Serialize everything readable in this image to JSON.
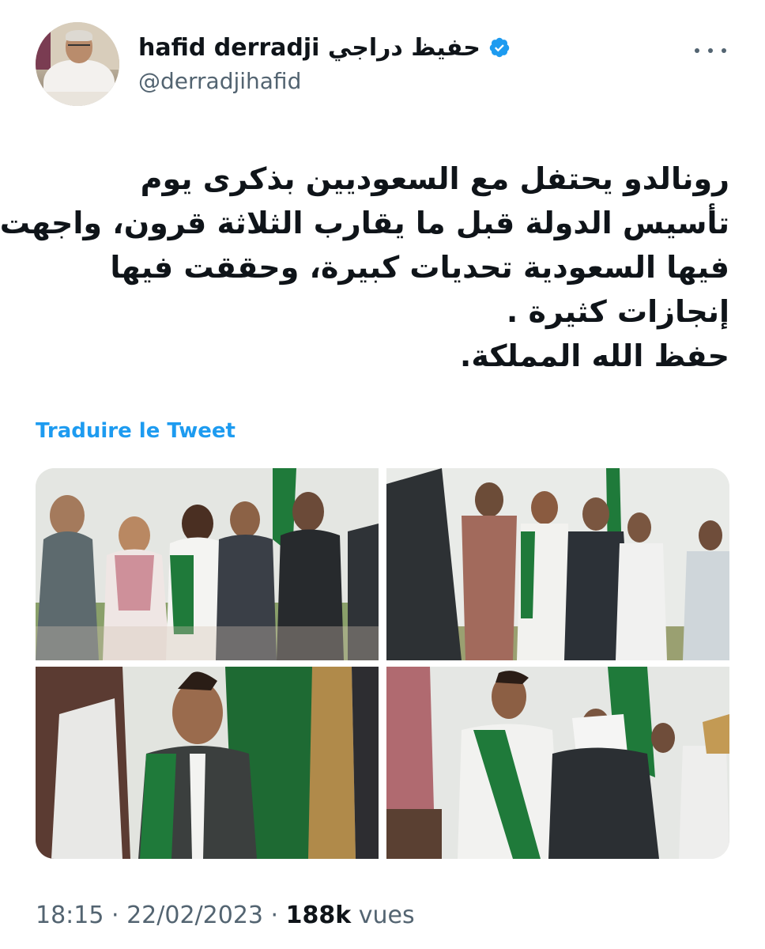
{
  "user": {
    "display_name": "hafid derradji حفيظ دراجي",
    "handle": "@derradjihafid",
    "verified_icon": "verified-badge-icon",
    "verified_color": "#1d9bf0"
  },
  "tweet": {
    "lines": [
      "رونالدو يحتفل مع السعوديين بذكرى يوم",
      "تأسيس الدولة قبل ما يقارب الثلاثة قرون، واجهت",
      "فيها السعودية تحديات كبيرة، وحققت فيها",
      "إنجازات كثيرة .",
      "حفظ الله المملكة."
    ],
    "translate_label": "Traduire le Tweet"
  },
  "meta": {
    "time": "18:15",
    "sep1": " · ",
    "date": "22/02/2023",
    "sep2": " · ",
    "views_count": "188k",
    "views_label": " vues"
  },
  "colors": {
    "text": "#0f1419",
    "secondary": "#536471",
    "link": "#1d9bf0",
    "flag_green": "#1f7a3a"
  }
}
